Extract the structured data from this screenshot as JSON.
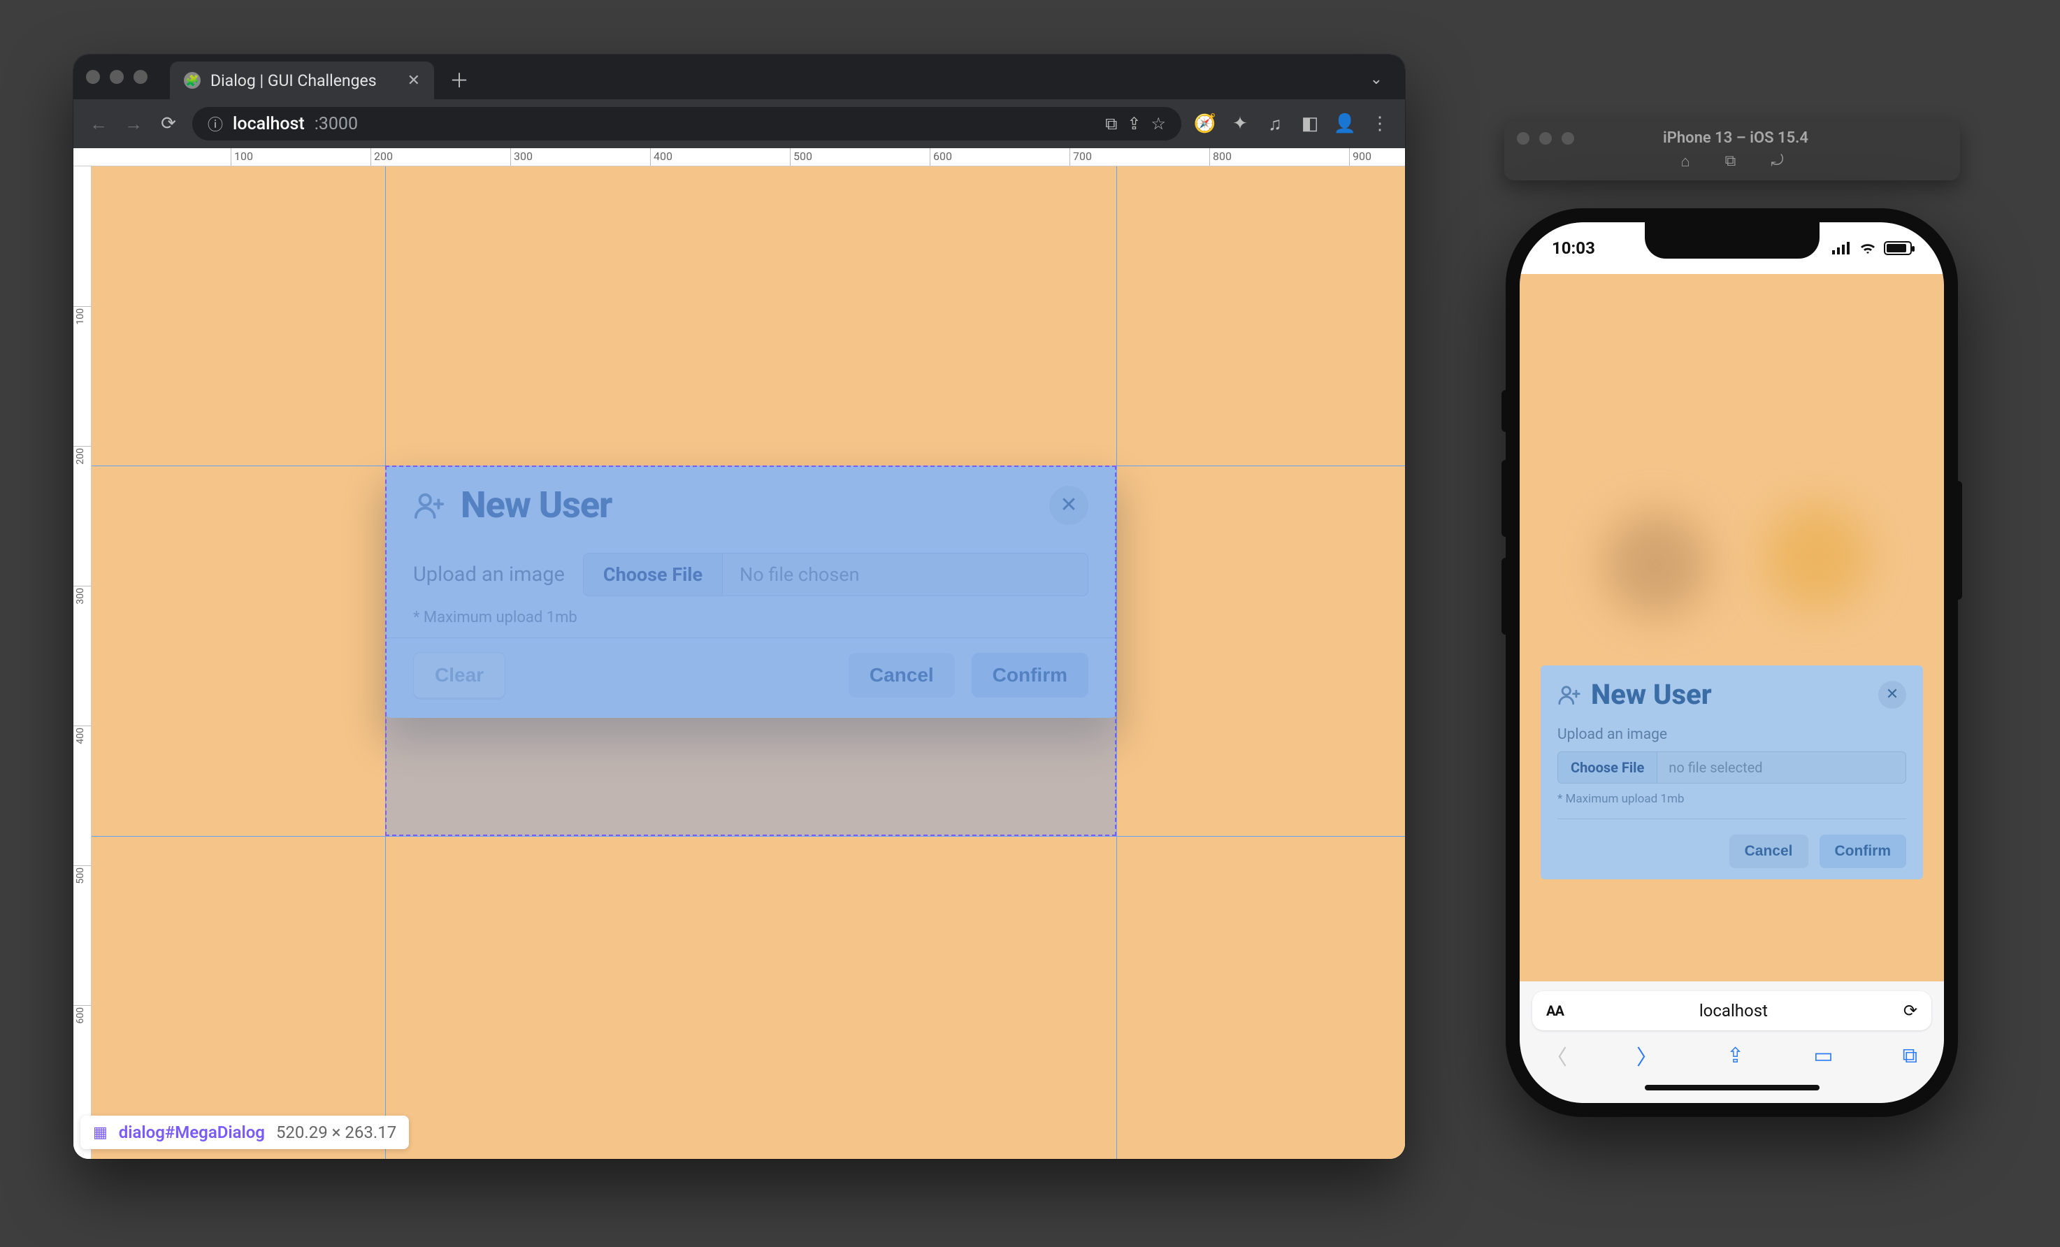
{
  "browser": {
    "tab_title": "Dialog | GUI Challenges",
    "url_host": "localhost",
    "url_port": ":3000",
    "ruler_h": [
      "100",
      "200",
      "300",
      "400",
      "500",
      "600",
      "700",
      "800",
      "900"
    ],
    "ruler_v": [
      "100",
      "200",
      "300",
      "400",
      "500",
      "600"
    ],
    "inspect": {
      "selector": "dialog#MegaDialog",
      "dims": "520.29 × 263.17"
    }
  },
  "dialog": {
    "title": "New User",
    "upload_label": "Upload an image",
    "choose_file": "Choose File",
    "no_file": "No file chosen",
    "hint": "* Maximum upload 1mb",
    "clear": "Clear",
    "cancel": "Cancel",
    "confirm": "Confirm"
  },
  "simulator": {
    "title": "iPhone 13 – iOS 15.4",
    "status_time": "10:03",
    "safari_url": "localhost"
  },
  "phone_dialog": {
    "title": "New User",
    "upload_label": "Upload an image",
    "choose_file": "Choose File",
    "no_file": "no file selected",
    "hint": "* Maximum upload 1mb",
    "cancel": "Cancel",
    "confirm": "Confirm"
  }
}
